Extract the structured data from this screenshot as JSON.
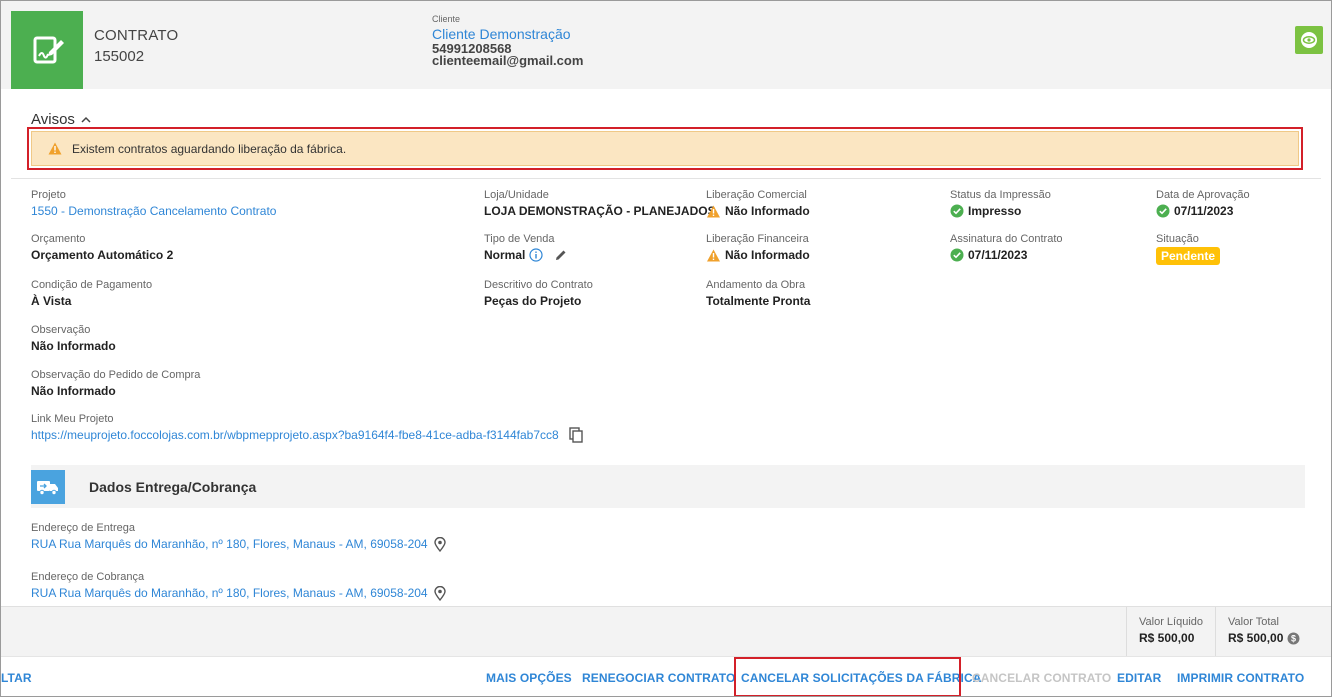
{
  "header": {
    "contract_type": "CONTRATO",
    "contract_number": "155002",
    "client_label": "Cliente",
    "client_name": "Cliente Demonstração",
    "client_phone": "54991208568",
    "client_email": "clienteemail@gmail.com",
    "logo_icon": "contract-edit-icon",
    "corner_icon": "eye-icon"
  },
  "avisos": {
    "title": "Avisos",
    "alert_text": "Existem contratos aguardando liberação da fábrica."
  },
  "fields": {
    "projeto": {
      "label": "Projeto",
      "value": "1550 - Demonstração Cancelamento Contrato"
    },
    "orcamento": {
      "label": "Orçamento",
      "value": "Orçamento Automático 2"
    },
    "condicao": {
      "label": "Condição de Pagamento",
      "value": "À Vista"
    },
    "observacao": {
      "label": "Observação",
      "value": "Não Informado"
    },
    "obs_pedido": {
      "label": "Observação do Pedido de Compra",
      "value": "Não Informado"
    },
    "link": {
      "label": "Link Meu Projeto",
      "value": "https://meuprojeto.foccolojas.com.br/wbpmepprojeto.aspx?ba9164f4-fbe8-41ce-adba-f3144fab7cc8"
    },
    "loja": {
      "label": "Loja/Unidade",
      "value": "LOJA DEMONSTRAÇÃO - PLANEJADOS"
    },
    "tipo_venda": {
      "label": "Tipo de Venda",
      "value": "Normal"
    },
    "descritivo": {
      "label": "Descritivo do Contrato",
      "value": "Peças do Projeto"
    },
    "lib_comercial": {
      "label": "Liberação Comercial",
      "value": "Não Informado"
    },
    "lib_financeira": {
      "label": "Liberação Financeira",
      "value": "Não Informado"
    },
    "andamento": {
      "label": "Andamento da Obra",
      "value": "Totalmente Pronta"
    },
    "status_impressao": {
      "label": "Status da Impressão",
      "value": "Impresso"
    },
    "assinatura": {
      "label": "Assinatura do Contrato",
      "value": "07/11/2023"
    },
    "data_aprovacao": {
      "label": "Data de Aprovação",
      "value": "07/11/2023"
    },
    "situacao": {
      "label": "Situação",
      "value": "Pendente"
    }
  },
  "entrega": {
    "section_title": "Dados Entrega/Cobrança",
    "endereco_entrega_label": "Endereço de Entrega",
    "endereco_entrega": "RUA Rua Marquês do Maranhão, nº 180, Flores, Manaus - AM, 69058-204",
    "endereco_cobranca_label": "Endereço de Cobrança",
    "endereco_cobranca": "RUA Rua Marquês do Maranhão, nº 180, Flores, Manaus - AM, 69058-204"
  },
  "totals": {
    "liquido_label": "Valor Líquido",
    "liquido_value": "R$ 500,00",
    "total_label": "Valor Total",
    "total_value": "R$ 500,00"
  },
  "actions": {
    "voltar": "LTAR",
    "mais_opcoes": "MAIS OPÇÕES",
    "renegociar": "RENEGOCIAR CONTRATO",
    "cancelar_solicitacoes": "CANCELAR SOLICITAÇÕES DA FÁBRICA",
    "cancelar_contrato": "CANCELAR CONTRATO",
    "editar": "EDITAR",
    "imprimir": "IMPRIMIR CONTRATO"
  },
  "colors": {
    "primary": "#2f86d6",
    "green": "#4caf50",
    "warning": "#f0a12c",
    "highlight_outline": "#d32029",
    "badge": "#ffc107"
  }
}
